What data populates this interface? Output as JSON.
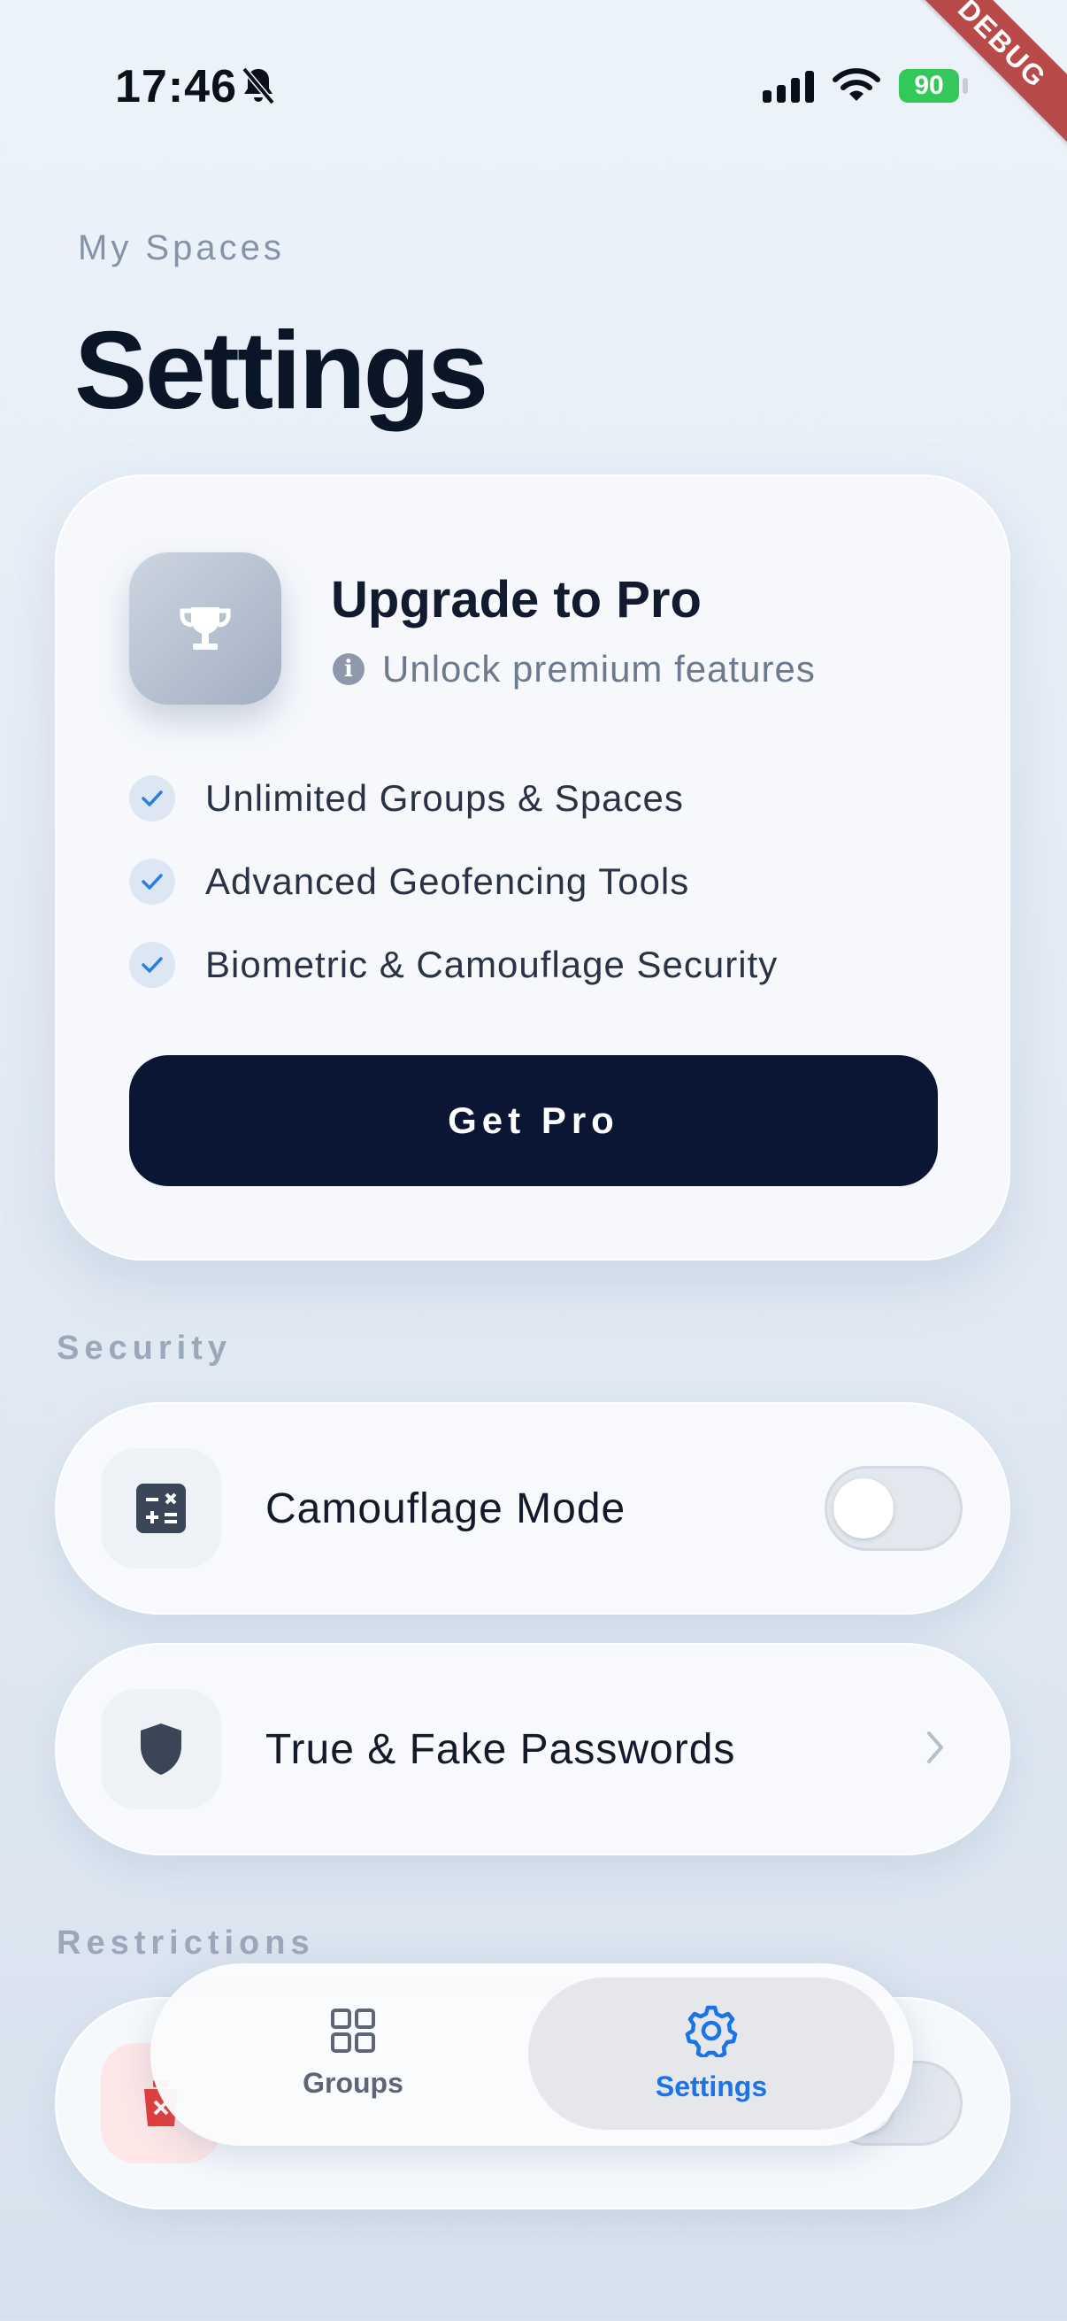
{
  "status_bar": {
    "time": "17:46",
    "battery": "90"
  },
  "debug_banner": "DEBUG",
  "header": {
    "eyebrow": "My Spaces",
    "title": "Settings"
  },
  "pro_card": {
    "title": "Upgrade to Pro",
    "subtitle": "Unlock premium features",
    "features": [
      "Unlimited Groups & Spaces",
      "Advanced Geofencing Tools",
      "Biometric & Camouflage Security"
    ],
    "button_label": "Get Pro"
  },
  "sections": {
    "security": "Security",
    "restrictions": "Restrictions"
  },
  "security_rows": [
    {
      "label": "Camouflage Mode",
      "icon": "calculator-icon",
      "toggle_on": false
    },
    {
      "label": "True & Fake Passwords",
      "icon": "shield-icon"
    }
  ],
  "restrictions_rows": [
    {
      "icon": "delete-icon",
      "toggle_on": false
    }
  ],
  "bottom_nav": {
    "items": [
      {
        "label": "Groups",
        "icon": "grid-icon",
        "active": false
      },
      {
        "label": "Settings",
        "icon": "gear-icon",
        "active": true
      }
    ]
  },
  "colors": {
    "accent": "#1a73e8",
    "primary_button": "#0a1633",
    "danger_tile": "#fde7e7",
    "danger_icon": "#e53935"
  }
}
